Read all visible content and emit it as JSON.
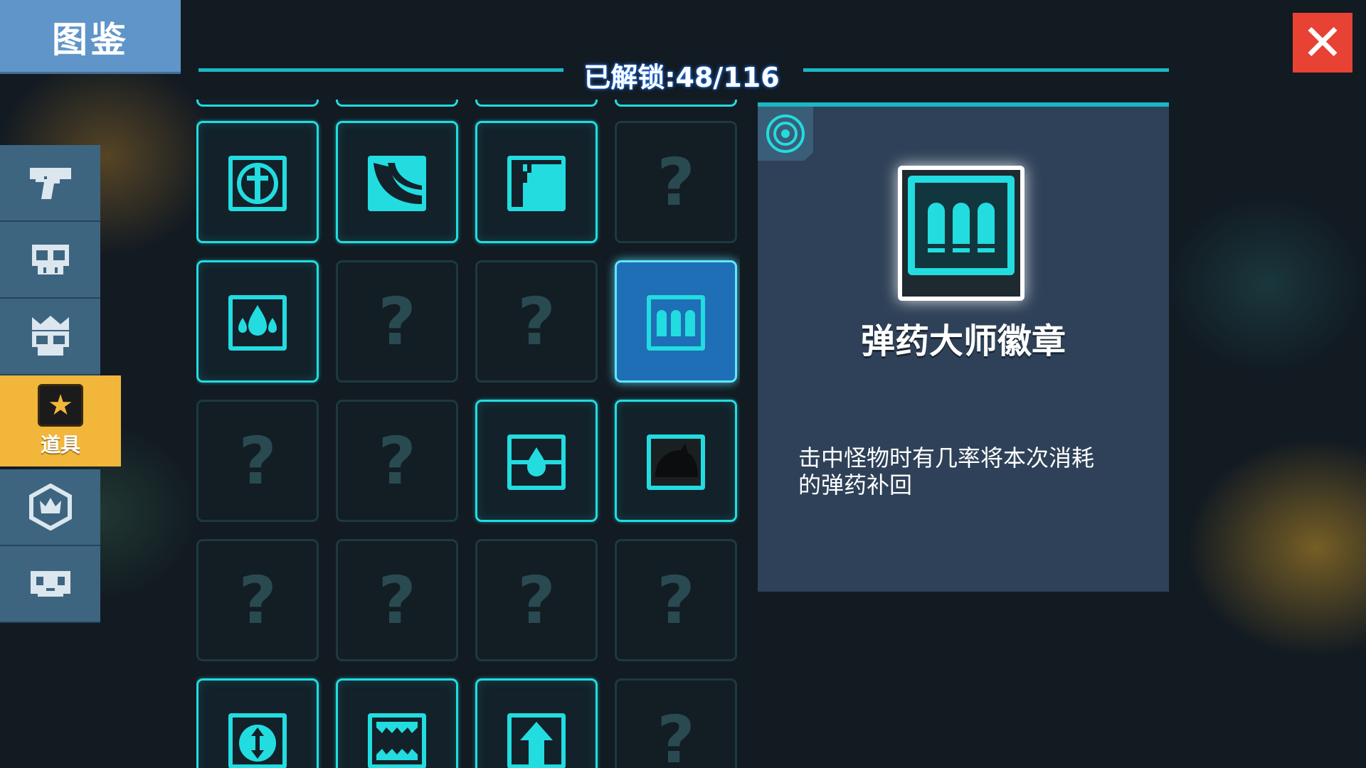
{
  "header": {
    "title": "图鉴",
    "unlock_text": "已解锁:48/116",
    "close_icon": "close-icon"
  },
  "sidebar": {
    "items": [
      {
        "icon": "pistol-icon",
        "label": ""
      },
      {
        "icon": "skull-icon",
        "label": ""
      },
      {
        "icon": "crowned-skull-icon",
        "label": ""
      },
      {
        "icon": "star-icon",
        "label": "道具",
        "active": true
      },
      {
        "icon": "hexagon-crown-icon",
        "label": ""
      },
      {
        "icon": "pixel-face-icon",
        "label": ""
      }
    ]
  },
  "grid": {
    "locked_glyph": "?",
    "rows": [
      [
        "cross-shield",
        "crescent-wave",
        "fist",
        "locked"
      ],
      [
        "water-drops",
        "locked",
        "locked",
        "ammo-bullets"
      ],
      [
        "locked",
        "locked",
        "drop-cross",
        "dark-helmet"
      ],
      [
        "locked",
        "locked",
        "locked",
        "locked"
      ],
      [
        "vertical-arrows",
        "jaw-trap",
        "up-arrow",
        "locked"
      ]
    ],
    "selected": "ammo-bullets"
  },
  "detail": {
    "corner_icon": "target-icon",
    "item_icon": "ammo-bullets-icon",
    "name": "弹药大师徽章",
    "description_line1": "击中怪物时有几率将本次消耗",
    "description_line2": "的弹药补回"
  },
  "colors": {
    "accent_cyan": "#22dce0",
    "selected_blue": "#1f6fb6",
    "active_tab": "#f2b63a",
    "close_red": "#e74234"
  }
}
